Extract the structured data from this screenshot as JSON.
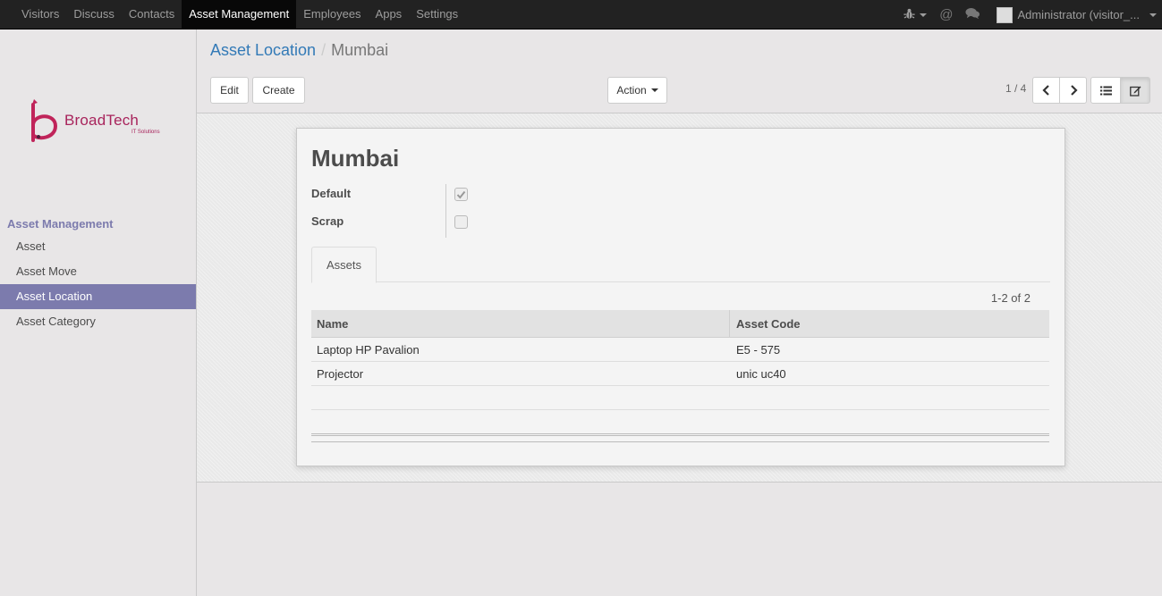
{
  "topbar": {
    "menu": [
      "Visitors",
      "Discuss",
      "Contacts",
      "Asset Management",
      "Employees",
      "Apps",
      "Settings"
    ],
    "active_index": 3,
    "user": "Administrator (visitor_..."
  },
  "sidebar": {
    "logo_brand": "BroadTech",
    "logo_tagline": "IT Solutions",
    "heading": "Asset Management",
    "items": [
      "Asset",
      "Asset Move",
      "Asset Location",
      "Asset Category"
    ],
    "active_index": 2
  },
  "control": {
    "breadcrumb_parent": "Asset Location",
    "breadcrumb_separator": "/",
    "breadcrumb_current": "Mumbai",
    "edit_label": "Edit",
    "create_label": "Create",
    "action_label": "Action",
    "pager": "1 / 4"
  },
  "record": {
    "name": "Mumbai",
    "fields": [
      {
        "label": "Default",
        "checked": true
      },
      {
        "label": "Scrap",
        "checked": false
      }
    ]
  },
  "tabs": {
    "assets_label": "Assets"
  },
  "list": {
    "pager": "1-2 of 2",
    "columns": [
      "Name",
      "Asset Code"
    ],
    "rows": [
      [
        "Laptop HP Pavalion",
        "E5 - 575"
      ],
      [
        "Projector",
        "unic uc40"
      ]
    ]
  },
  "colors": {
    "accent": "#7c7bad",
    "link": "#337ab7",
    "brand": "#a8245c",
    "navbar": "#222222"
  }
}
